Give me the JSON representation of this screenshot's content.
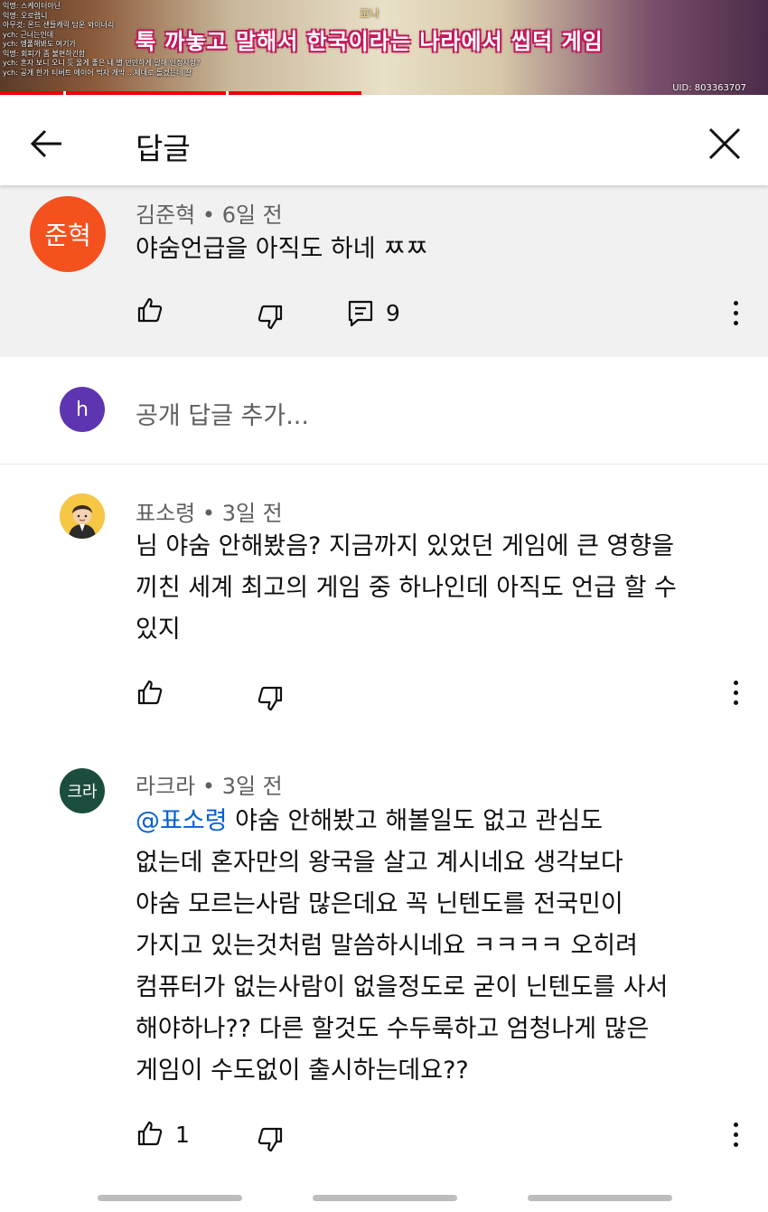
{
  "video": {
    "chat_lines": [
      "익명: 스케이터아닌",
      "익명: 오로랩니",
      "아무것: 온드 샌들캐릭 담운 와이너리",
      "ych: 근너는인데",
      "ych: 엥풀해봐도 여기가",
      "익명: 회피가 좀 불편하긴함",
      "ych: 혼자 보니 오니 듯 울게 좋은 네 별 만만하게 말해 인정사항?",
      "ych: 공개 한가 티버트 에이어 먹자 개막 ...제대로 돌겠는데 잘"
    ],
    "speaker": "모나",
    "subtitle": "툭 까놓고 말해서 한국이라는 나라에서 씹덕 게임",
    "uid": "UID: 803363707",
    "progress": 0.47
  },
  "header": {
    "title": "답글",
    "back_icon": "arrow-left-icon",
    "close_icon": "close-icon"
  },
  "parent_comment": {
    "avatar_text": "준혁",
    "avatar_color": "#f4511e",
    "author": "김준혁",
    "age": "6일 전",
    "text": "야숨언급을 아직도 하네 ㅉㅉ",
    "reply_count": "9"
  },
  "reply_box": {
    "avatar_text": "h",
    "avatar_color": "#5e35b1",
    "placeholder": "공개 답글 추가..."
  },
  "replies": [
    {
      "author": "표소령",
      "age": "3일 전",
      "lines": [
        "님 야숨 안해봤음? 지금까지 있었던 게임에 큰 영향을",
        "끼친 세계 최고의 게임 중 하나인데 아직도 언급 할 수",
        "있지"
      ]
    },
    {
      "avatar_text": "크라",
      "avatar_color": "#1b4d3e",
      "author": "라크라",
      "age": "3일 전",
      "mention": "@표소령",
      "lines": [
        " 야숨 안해봤고 해볼일도 없고 관심도",
        "없는데 혼자만의 왕국을 살고 계시네요  생각보다",
        "야숨 모르는사람 많은데요 꼭 닌텐도를 전국민이",
        "가지고 있는것처럼 말씀하시네요 ㅋㅋㅋㅋ 오히려",
        "컴퓨터가 없는사람이 없을정도로 굳이 닌텐도를 사서",
        "해야하나??  다른 할것도 수두룩하고 엄청나게 많은",
        "게임이 수도없이 출시하는데요??"
      ],
      "like_count": "1"
    }
  ],
  "colors": {
    "mention": "#065fd4",
    "meta": "#606060",
    "parent_bg": "#f1f1f1"
  }
}
